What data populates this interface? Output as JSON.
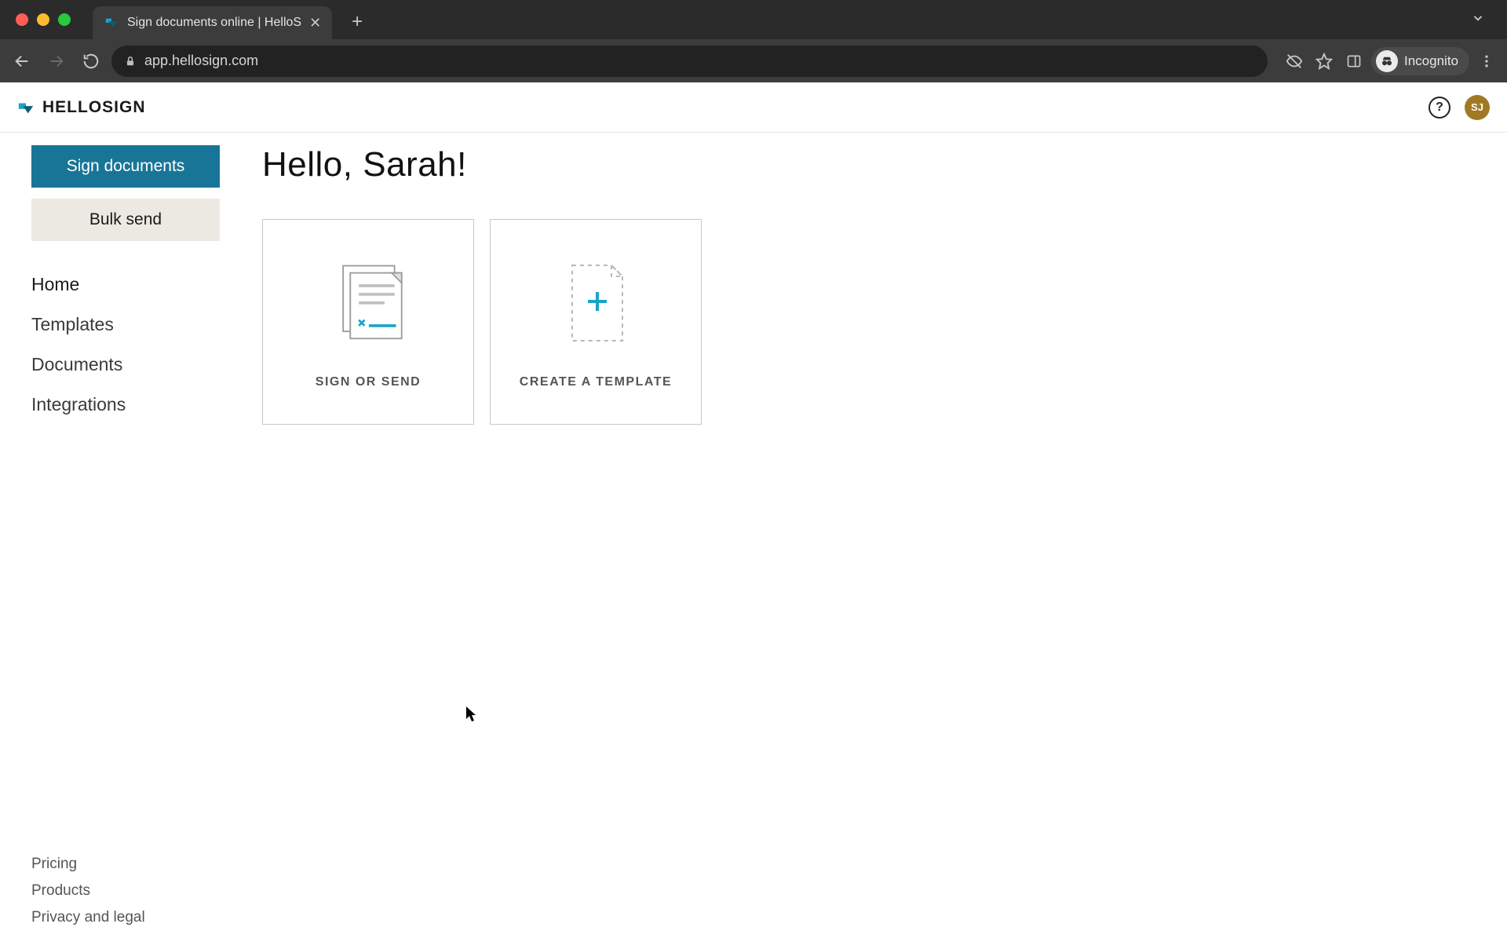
{
  "browser": {
    "tab_title": "Sign documents online | HelloS",
    "url": "app.hellosign.com",
    "incognito_label": "Incognito"
  },
  "header": {
    "logo_text": "HELLOSIGN",
    "avatar_initials": "SJ"
  },
  "sidebar": {
    "primary_button": "Sign documents",
    "secondary_button": "Bulk send",
    "nav": [
      "Home",
      "Templates",
      "Documents",
      "Integrations"
    ],
    "footer": [
      "Pricing",
      "Products",
      "Privacy and legal"
    ]
  },
  "main": {
    "greeting": "Hello, Sarah!",
    "cards": [
      {
        "label": "SIGN OR SEND"
      },
      {
        "label": "CREATE A TEMPLATE"
      }
    ]
  },
  "colors": {
    "primary": "#187598",
    "accent": "#1aa3c6"
  }
}
